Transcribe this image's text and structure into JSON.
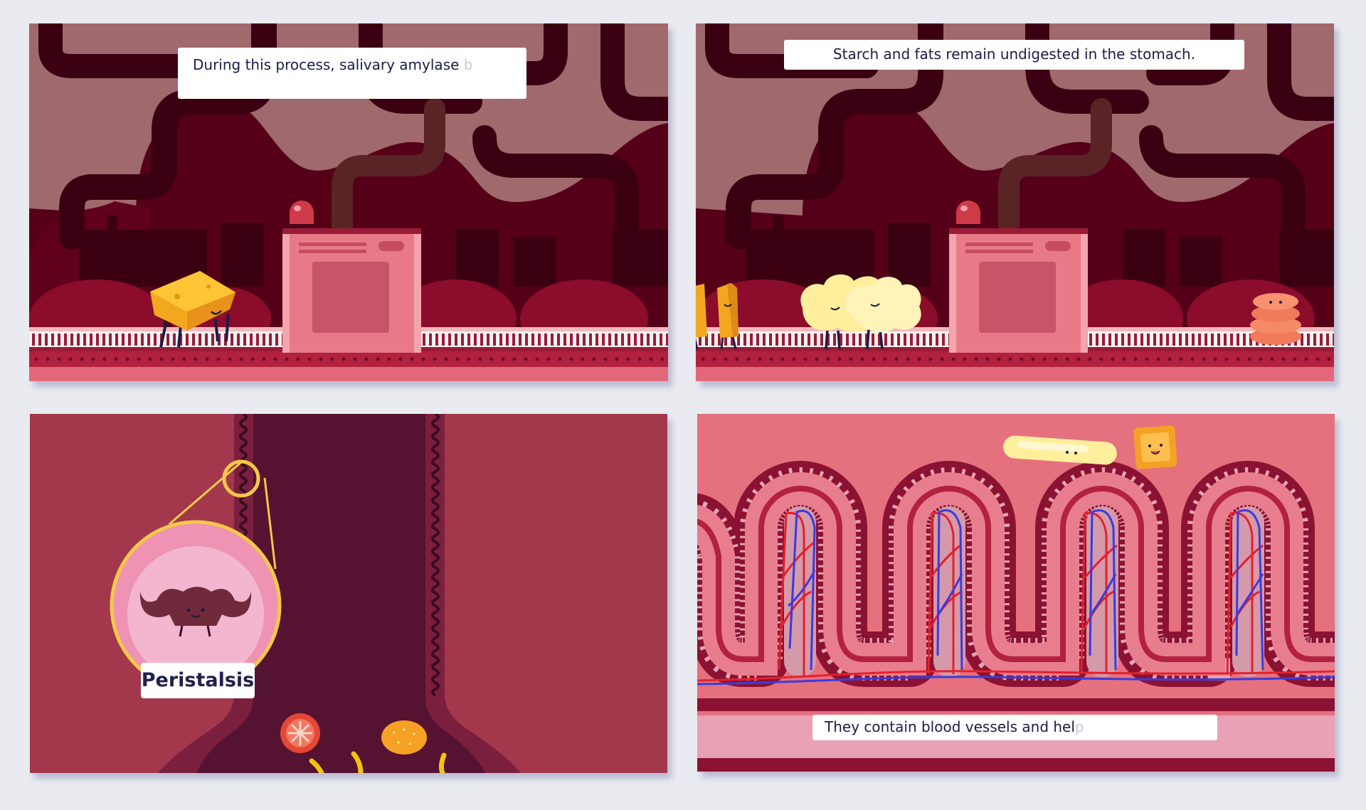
{
  "panels": [
    {
      "caption_visible": "During this process, salivary amylase",
      "caption_faded": "b"
    },
    {
      "caption_visible": "Starch and fats remain undigested in the stomach.",
      "caption_faded": ""
    },
    {
      "label": "Peristalsis"
    },
    {
      "caption_visible": "They contain blood vessels and hel",
      "caption_faded": "p"
    }
  ],
  "colors": {
    "page_background": "#e9ebf0",
    "stomach_sky": "#a0696d",
    "stomach_dark": "#550018",
    "machine_pink": "#e87a88",
    "esophagus_wall": "#a3384d",
    "esophagus_lumen": "#551231",
    "villi_pink": "#e5717f",
    "artery_red": "#e4212c",
    "vein_blue": "#3b3bdc",
    "caption_text": "#1c1c47"
  }
}
